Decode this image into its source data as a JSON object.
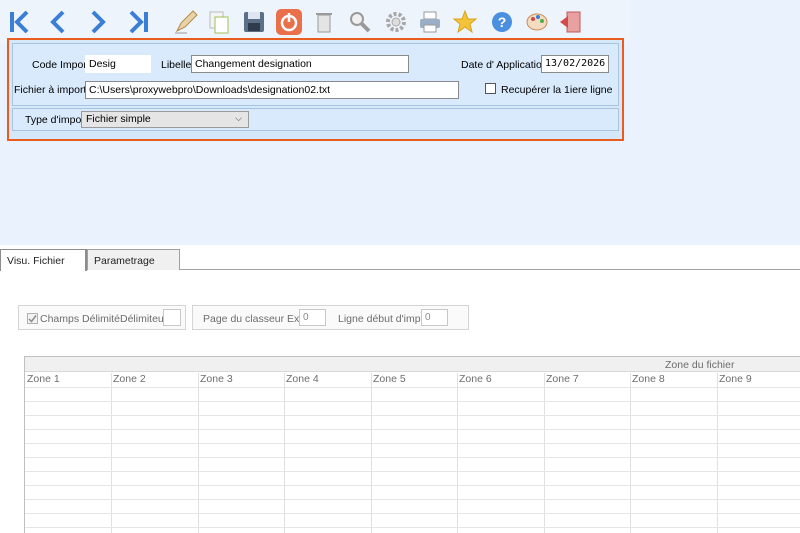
{
  "toolbar": {
    "buttons": [
      {
        "name": "first-record-icon",
        "color": "#3a7fd5"
      },
      {
        "name": "previous-record-icon",
        "color": "#3a7fd5"
      },
      {
        "name": "next-record-icon",
        "color": "#3a7fd5"
      },
      {
        "name": "last-record-icon",
        "color": "#3a7fd5"
      },
      {
        "name": "edit-pencil-icon",
        "color": "#c9a26a"
      },
      {
        "name": "copy-document-icon",
        "color": "#9fbf5a"
      },
      {
        "name": "save-floppy-icon",
        "color": "#5b6f86"
      },
      {
        "name": "power-icon",
        "color": "#e0584a"
      },
      {
        "name": "delete-bin-icon",
        "color": "#8a8a8a"
      },
      {
        "name": "search-magnifier-icon",
        "color": "#8a8a8a"
      },
      {
        "name": "settings-gear-icon",
        "color": "#8a8a8a"
      },
      {
        "name": "print-icon",
        "color": "#6a7f9b"
      },
      {
        "name": "favorite-star-icon",
        "color": "#f2c43a"
      },
      {
        "name": "help-icon",
        "color": "#3a7fd5"
      },
      {
        "name": "palette-icon",
        "color": "#c98a5a"
      },
      {
        "name": "exit-door-icon",
        "color": "#d34a4a"
      }
    ]
  },
  "form": {
    "code_import_label": "Code Import:",
    "code_import_value": "Desig",
    "libelle_label": "Libelle:",
    "libelle_value": "Changement designation",
    "date_label": "Date d' Application:",
    "date_value": "13/02/2026",
    "file_label": "Fichier à importer:",
    "file_value": "C:\\Users\\proxywebpro\\Downloads\\designation02.txt",
    "first_line_label": "Recupérer la 1iere ligne",
    "first_line_checked": false,
    "import_type_label": "Type d'import:",
    "import_type_value": "Fichier simple",
    "highlight_color": "#e95c1d"
  },
  "tabs": [
    {
      "label": "Visu. Fichier",
      "active": true
    },
    {
      "label": "Parametrage",
      "active": false
    }
  ],
  "options": {
    "delimited_label": "Champs Délimité",
    "delimited_checked": true,
    "delimiter_label": "Délimiteur:",
    "delimiter_value": "",
    "excel_page_label": "Page du classeur Excel:",
    "excel_page_value": "0",
    "start_line_label": "Ligne début d'import:",
    "start_line_value": "0"
  },
  "grid": {
    "group_header": "Zone du fichier",
    "columns": [
      "Zone 1",
      "Zone 2",
      "Zone 3",
      "Zone 4",
      "Zone 5",
      "Zone 6",
      "Zone 7",
      "Zone 8",
      "Zone 9"
    ]
  }
}
